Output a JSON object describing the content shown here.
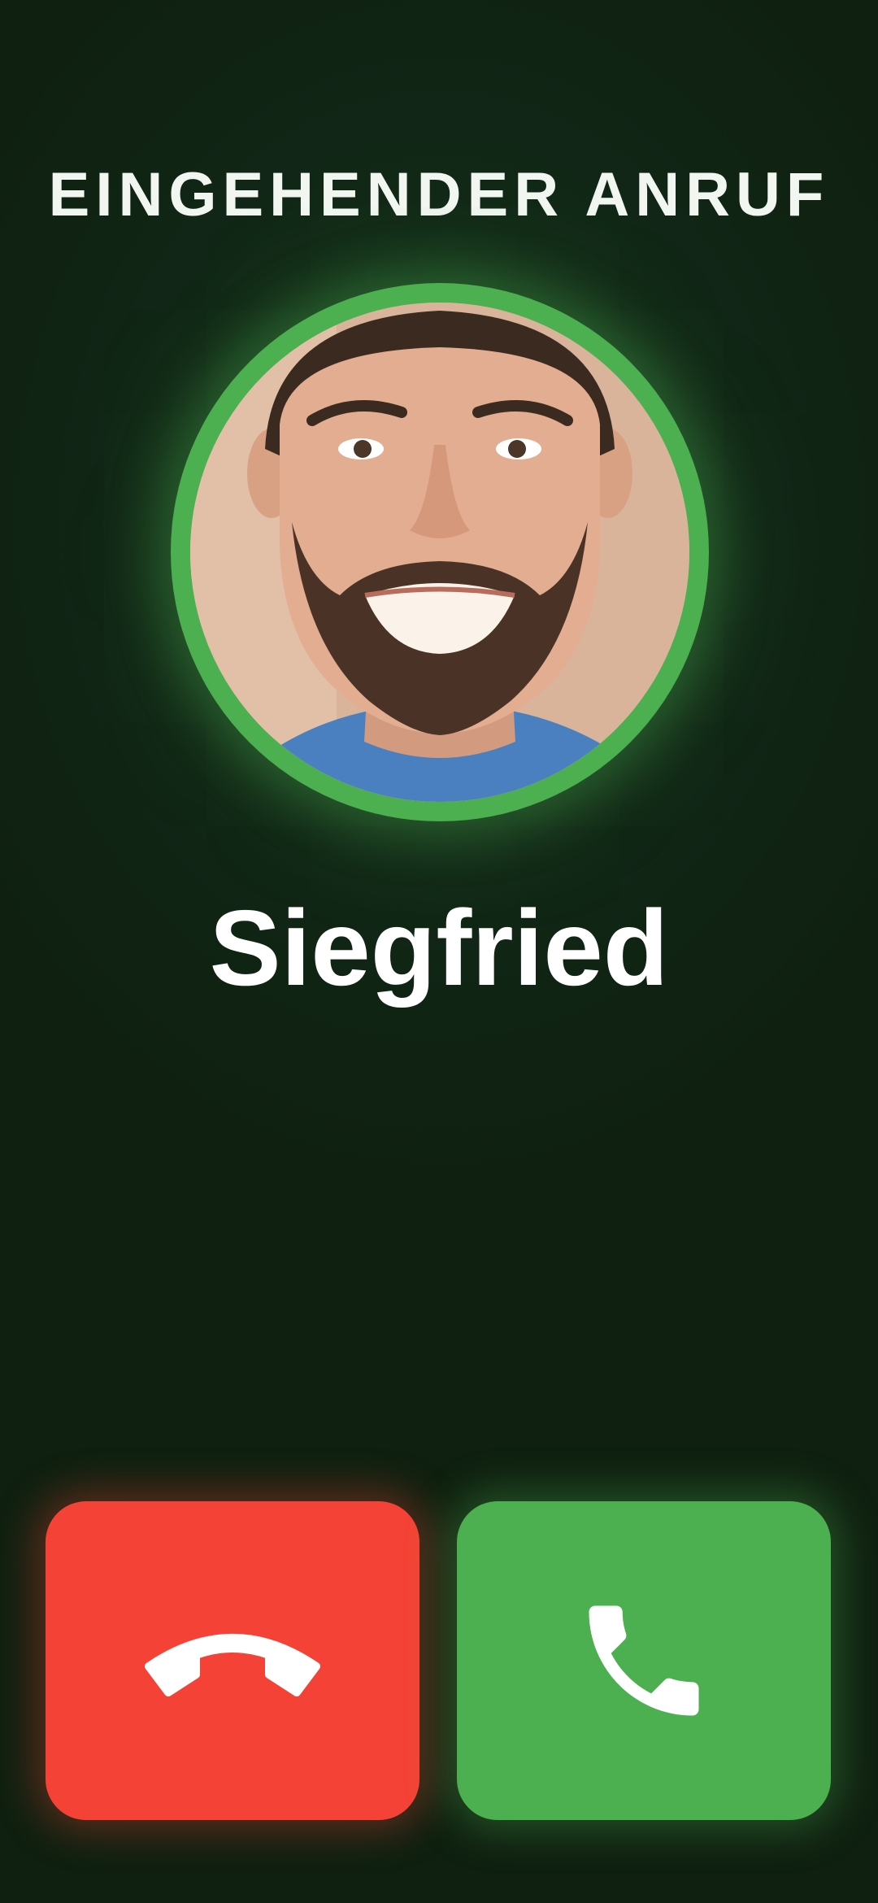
{
  "call": {
    "status_label": "EINGEHENDER ANRUF",
    "caller_name": "Siegfried"
  },
  "actions": {
    "decline_icon": "phone-hangup-icon",
    "accept_icon": "phone-icon"
  },
  "colors": {
    "background": "#0f2010",
    "accent_green": "#4caf50",
    "decline_red": "#f44336",
    "text": "#ffffff"
  }
}
